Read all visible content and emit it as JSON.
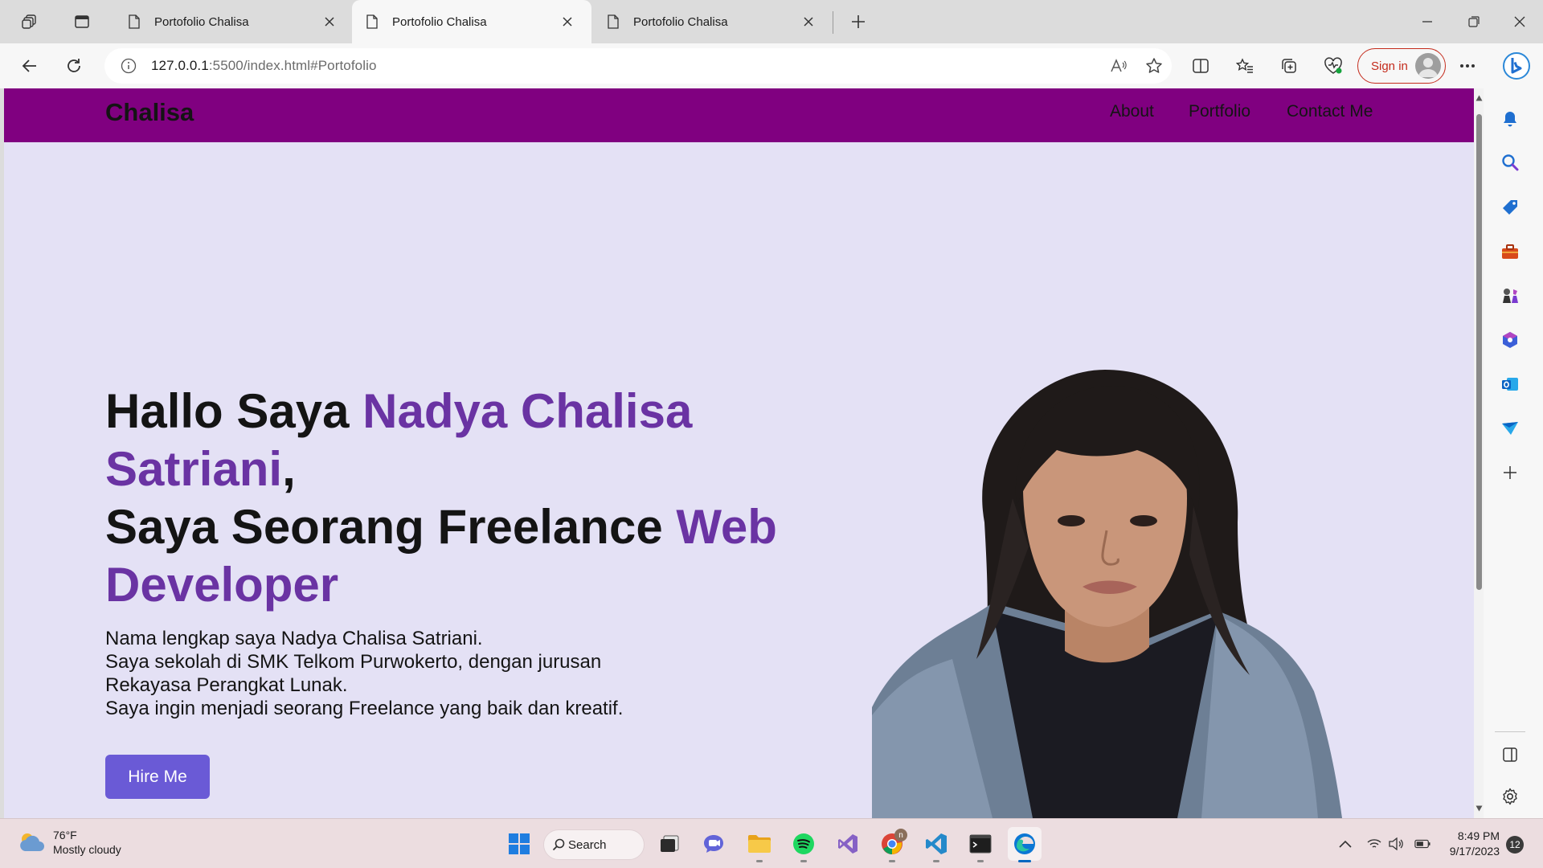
{
  "browser": {
    "tabs": [
      {
        "title": "Portofolio Chalisa",
        "active": false
      },
      {
        "title": "Portofolio Chalisa",
        "active": true
      },
      {
        "title": "Portofolio Chalisa",
        "active": false
      }
    ],
    "address": {
      "host": "127.0.0.1",
      "rest": ":5500/index.html#Portofolio"
    },
    "sign_in_label": "Sign in"
  },
  "page": {
    "brand": "Chalisa",
    "nav": [
      "About",
      "Portfolio",
      "Contact Me"
    ],
    "hero": {
      "t1": "Hallo Saya ",
      "t2": "Nadya Chalisa Satriani",
      "t3": ",",
      "t4": "Saya Seorang Freelance ",
      "t5": "Web Developer"
    },
    "desc": [
      "Nama lengkap saya Nadya Chalisa Satriani.",
      "Saya sekolah di SMK Telkom Purwokerto, dengan jurusan",
      "Rekayasa Perangkat Lunak.",
      "Saya ingin menjadi seorang Freelance yang baik dan kreatif."
    ],
    "cta": "Hire Me"
  },
  "taskbar": {
    "weather": {
      "temp": "76°F",
      "condition": "Mostly cloudy"
    },
    "search_label": "Search",
    "chrome_badge": "n",
    "clock": {
      "time": "8:49 PM",
      "date": "9/17/2023"
    },
    "notifications": "12"
  },
  "colors": {
    "nav_bg": "#800080",
    "page_bg": "#e4e1f5",
    "accent_text": "#6a33a3",
    "button": "#6a5ad6"
  }
}
